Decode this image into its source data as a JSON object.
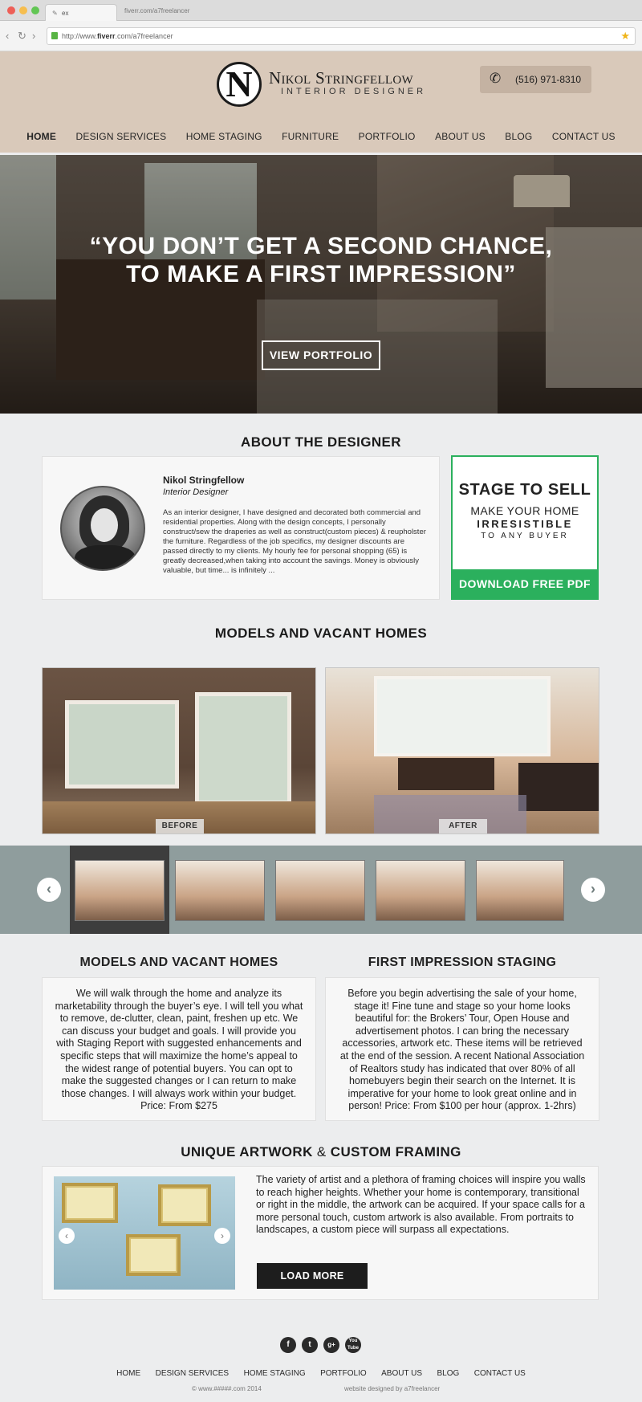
{
  "browser": {
    "tab_title": "ex",
    "tab_url_hint": "fiverr.com/a7freelancer",
    "address_prefix": "http://www.",
    "address_domain": "fiverr",
    "address_suffix": ".com/a7freelancer"
  },
  "header": {
    "logo_letter": "N",
    "brand_name": "Nikol Stringfellow",
    "brand_subtitle": "INTERIOR DESIGNER",
    "phone": "(516) 971-8310",
    "nav": [
      "HOME",
      "DESIGN SERVICES",
      "HOME STAGING",
      "FURNITURE",
      "PORTFOLIO",
      "ABOUT US",
      "BLOG",
      "CONTACT US"
    ]
  },
  "hero": {
    "quote_line1": "“YOU DON’T GET A SECOND CHANCE,",
    "quote_line2": "TO MAKE A FIRST IMPRESSION”",
    "button": "VIEW PORTFOLIO"
  },
  "about": {
    "section_title": "ABOUT THE DESIGNER",
    "name": "Nikol Stringfellow",
    "role": "Interior Designer",
    "text": "As an interior designer, I have designed and decorated both commercial and residential properties. Along with the design concepts, I personally construct/sew the draperies as well as construct(custom pieces) & reupholster the furniture. Regardless of the job specifics, my designer discounts are passed directly to my clients. My hourly fee for personal shopping (65) is greatly decreased,when taking into account the savings. Money is obviously valuable, but time... is infinitely ..."
  },
  "stage": {
    "title": "STAGE TO SELL",
    "line1": "MAKE YOUR HOME",
    "line2": "IRRESISTIBLE",
    "line3": "TO ANY BUYER",
    "button": "DOWNLOAD FREE PDF"
  },
  "models": {
    "section_title": "MODELS AND VACANT HOMES",
    "before_label": "BEFORE",
    "after_label": "AFTER",
    "prev_arrow": "‹",
    "next_arrow": "›"
  },
  "columns": {
    "left_title": "MODELS AND VACANT HOMES",
    "left_text": "We will walk through the home and analyze its marketability through the buyer’s eye.  I will tell you what to remove, de-clutter, clean, paint, freshen up etc. We can discuss your budget and goals.  I will provide you with Staging Report with suggested enhancements and specific steps that will maximize the home’s appeal to the widest range of potential buyers. You can opt to make the suggested changes or I can return to make those changes. I will always work within your budget.     Price: From $275",
    "right_title": "FIRST IMPRESSION STAGING",
    "right_text": "Before you begin advertising the sale of your home, stage it! Fine tune and stage so your home looks beautiful for: the Brokers’ Tour, Open House and advertisement photos.  I can bring the necessary accessories, artwork etc. These items will be retrieved at the end of the session. A recent National Association of Realtors study has indicated that over 80% of all homebuyers begin their search on the Internet. It is imperative for your home to look great online and in person!     Price: From $100 per hour (approx. 1-2hrs)"
  },
  "artwork": {
    "title_part1": "UNIQUE ARTWORK",
    "title_amp": "&",
    "title_part2": "CUSTOM FRAMING",
    "text": "The variety of artist and a plethora of framing choices will inspire you walls to reach higher heights. Whether your home is contemporary, transitional or right in the middle, the artwork can be acquired. If your space calls for a more personal touch, custom artwork is also available. From portraits to landscapes, a custom piece will surpass all expectations.",
    "button": "LOAD MORE",
    "prev_arrow": "‹",
    "next_arrow": "›"
  },
  "footer": {
    "social": [
      "f",
      "t",
      "g+",
      "You Tube"
    ],
    "nav": [
      "HOME",
      "DESIGN SERVICES",
      "HOME STAGING",
      "PORTFOLIO",
      "ABOUT US",
      "BLOG",
      "CONTACT US"
    ],
    "copyright": "© www.#####.com    2014",
    "credit": "website designed by a7freelancer"
  },
  "colors": {
    "accent_green": "#2bb05d",
    "header_bg": "#d9c9ba",
    "strip_bg": "#8f9d9d"
  }
}
